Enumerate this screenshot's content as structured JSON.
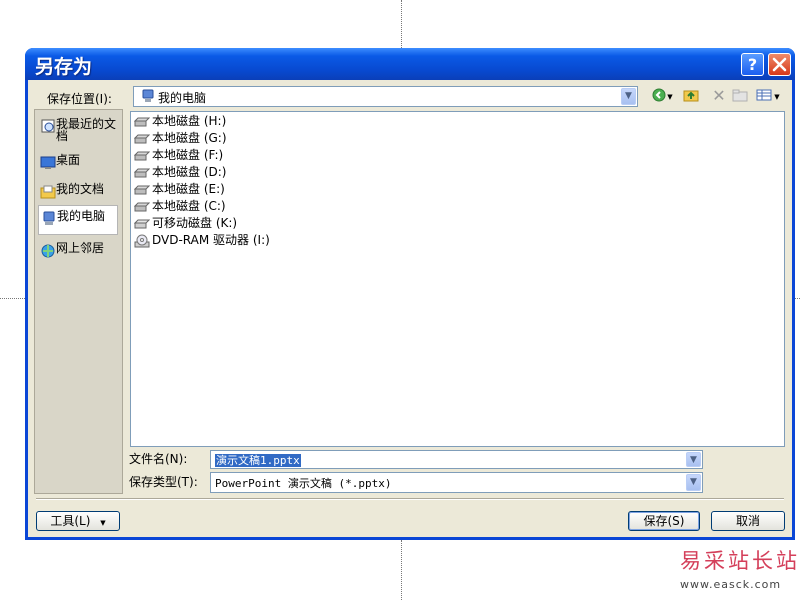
{
  "dialog": {
    "title": "另存为",
    "help_button": "?",
    "close_button": "✕"
  },
  "lookin": {
    "label": "保存位置(I):",
    "value": "我的电脑",
    "value_icon": "my-computer-icon"
  },
  "toolbar": {
    "icons": [
      "back-icon",
      "up-folder-icon",
      "delete-icon",
      "new-folder-icon",
      "views-icon"
    ]
  },
  "places": [
    {
      "label": "我最近的文档",
      "icon": "recent-documents-icon"
    },
    {
      "label": "桌面",
      "icon": "desktop-icon"
    },
    {
      "label": "我的文档",
      "icon": "my-documents-icon"
    },
    {
      "label": "我的电脑",
      "icon": "my-computer-icon",
      "selected": true
    },
    {
      "label": "网上邻居",
      "icon": "network-places-icon"
    }
  ],
  "files": [
    {
      "label": "本地磁盘 (H:)",
      "icon": "hard-disk-icon"
    },
    {
      "label": "本地磁盘 (G:)",
      "icon": "hard-disk-icon"
    },
    {
      "label": "本地磁盘 (F:)",
      "icon": "hard-disk-icon"
    },
    {
      "label": "本地磁盘 (D:)",
      "icon": "hard-disk-icon"
    },
    {
      "label": "本地磁盘 (E:)",
      "icon": "hard-disk-icon"
    },
    {
      "label": "本地磁盘 (C:)",
      "icon": "hard-disk-icon"
    },
    {
      "label": "可移动磁盘 (K:)",
      "icon": "removable-disk-icon"
    },
    {
      "label": "DVD-RAM 驱动器 (I:)",
      "icon": "dvd-drive-icon"
    }
  ],
  "filename": {
    "label": "文件名(N):",
    "value": "演示文稿1.pptx"
  },
  "filetype": {
    "label": "保存类型(T):",
    "value": "PowerPoint 演示文稿 (*.pptx)"
  },
  "buttons": {
    "tools": "工具(L)",
    "save": "保存(S)",
    "cancel": "取消"
  },
  "watermark": {
    "brand": "易采站长站",
    "url": "www.easck.com"
  },
  "colors": {
    "titlebar": "#0a46d6",
    "dialog_bg": "#ece9d8",
    "selection": "#316ac5",
    "watermark": "#d43f5a"
  }
}
